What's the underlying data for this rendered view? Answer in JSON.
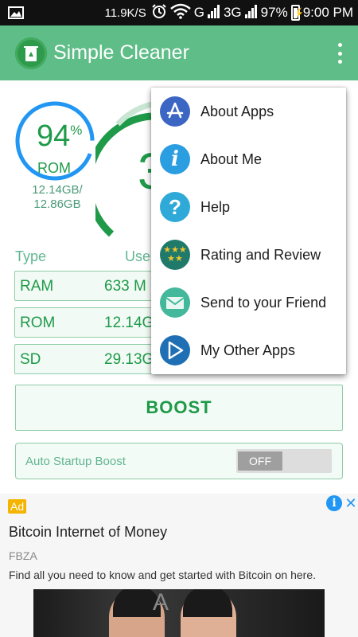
{
  "status_bar": {
    "speed": "11.9K/S",
    "network1": "G",
    "network2": "3G",
    "battery": "97%",
    "time": "9:00 PM"
  },
  "app": {
    "title": "Simple Cleaner",
    "colors": {
      "accent": "#5fbd88",
      "text_green": "#1e9a48",
      "ring_blue": "#2196f3"
    }
  },
  "storage": {
    "rom_percent": "94",
    "percent_sign": "%",
    "rom_label": "ROM",
    "rom_used": "12.14GB/",
    "rom_total": "12.86GB",
    "big_value_partial": "3"
  },
  "table": {
    "col_type": "Type",
    "col_used": "Use",
    "rows": [
      {
        "name": "RAM",
        "value": "633 M"
      },
      {
        "name": "ROM",
        "value": "12.14G"
      },
      {
        "name": "SD",
        "value": "29.13G"
      }
    ]
  },
  "boost_label": "BOOST",
  "auto_startup": {
    "label": "Auto Startup Boost",
    "toggle": "OFF"
  },
  "menu": {
    "items": [
      {
        "label": "About Apps",
        "icon": "app-store-icon"
      },
      {
        "label": "About Me",
        "icon": "info-icon"
      },
      {
        "label": "Help",
        "icon": "help-icon"
      },
      {
        "label": "Rating and Review",
        "icon": "stars-icon"
      },
      {
        "label": "Send to your Friend",
        "icon": "mail-icon"
      },
      {
        "label": "My Other Apps",
        "icon": "play-store-icon"
      }
    ]
  },
  "ad": {
    "badge": "Ad",
    "title": "Bitcoin Internet of Money",
    "advertiser": "FBZA",
    "description": "Find all you need to know and get started with Bitcoin on here.",
    "image_letter": "A"
  }
}
